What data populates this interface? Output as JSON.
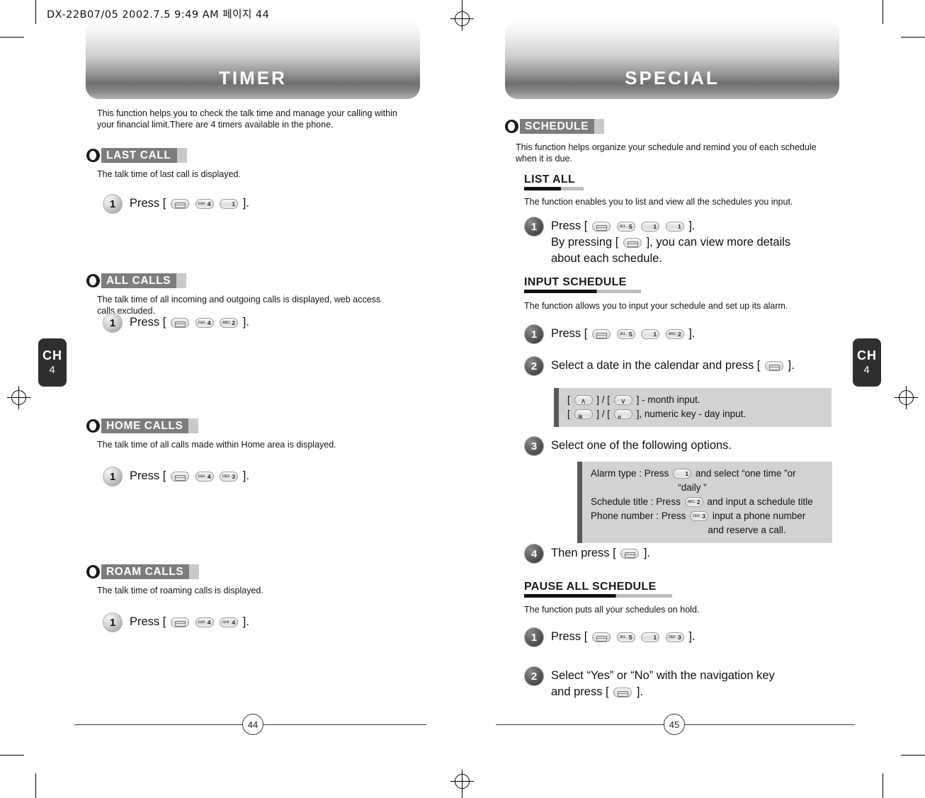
{
  "print_marks": {
    "header_text": "DX-22B07/05  2002.7.5 9:49 AM  페이지 44"
  },
  "left_page": {
    "title": "TIMER",
    "intro": "This function helps you to check the talk time and manage your calling within your financial limit.There are 4 timers available in the phone.",
    "chapter_tab": {
      "line1": "CH",
      "line2": "4"
    },
    "page_number": "44",
    "sections": [
      {
        "tag": "LAST CALL",
        "desc": "The talk time of last call is displayed.",
        "steps": [
          {
            "num": "1",
            "text": "Press [",
            "keys": [
              "send",
              "4ghi",
              "1"
            ],
            "text_end": "]."
          }
        ]
      },
      {
        "tag": "ALL CALLS",
        "desc": "The talk time of all incoming and outgoing calls is displayed, web access calls excluded.",
        "steps": [
          {
            "num": "1",
            "text": "Press [",
            "keys": [
              "send",
              "4ghi",
              "2abc"
            ],
            "text_end": "]."
          }
        ]
      },
      {
        "tag": "HOME CALLS",
        "desc": "The talk time of all calls made within Home area is displayed.",
        "steps": [
          {
            "num": "1",
            "text": "Press [",
            "keys": [
              "send",
              "4ghi",
              "3def"
            ],
            "text_end": "]."
          }
        ]
      },
      {
        "tag": "ROAM CALLS",
        "desc": "The talk time of roaming calls is displayed.",
        "steps": [
          {
            "num": "1",
            "text": "Press [",
            "keys": [
              "send",
              "4ghi",
              "4ghi"
            ],
            "text_end": "]."
          }
        ]
      }
    ]
  },
  "right_page": {
    "title": "SPECIAL",
    "chapter_tab": {
      "line1": "CH",
      "line2": "4"
    },
    "page_number": "45",
    "tag": "SCHEDULE",
    "intro": "This function helps organize your schedule and remind you of each schedule when it is due.",
    "blocks": [
      {
        "heading": "LIST ALL",
        "desc": "The function enables you to list and view all the schedules you input.",
        "steps": [
          {
            "num": "1",
            "line1_a": "Press [",
            "line1_keys": [
              "send",
              "5jkl",
              "1",
              "1"
            ],
            "line1_b": "].",
            "line2_a": "By pressing [",
            "line2_keys": [
              "send"
            ],
            "line2_b": "], you can view  more details",
            "line3": "about each schedule."
          }
        ]
      },
      {
        "heading": "INPUT SCHEDULE",
        "desc": "The function allows you to input your schedule and set up its alarm.",
        "steps": [
          {
            "num": "1",
            "line1_a": "Press [",
            "line1_keys": [
              "send",
              "5jkl",
              "1",
              "2abc"
            ],
            "line1_b": "]."
          },
          {
            "num": "2",
            "line1_a": "Select a date in the calendar and press [",
            "line1_keys": [
              "send"
            ],
            "line1_b": "]."
          },
          {
            "num": "3",
            "line1_a": "Select one of the following options."
          },
          {
            "num": "4",
            "line1_a": "Then press [",
            "line1_keys": [
              "send"
            ],
            "line1_b": "]."
          }
        ],
        "note_after_step2": [
          {
            "pre": "[",
            "key": "nav-up",
            "mid": "] / [",
            "key2": "nav-down",
            "post": "] - month input."
          },
          {
            "pre": "[",
            "key": "star",
            "mid": "] / [",
            "key2": "pound",
            "post": "], numeric key - day input."
          }
        ],
        "note_after_step3": [
          {
            "a": "Alarm type : Press",
            "key": "1",
            "b": "and select “one time ”or"
          },
          {
            "a": "“daily ”"
          },
          {
            "a": "Schedule title : Press",
            "key": "2abc",
            "b": "and input a schedule title"
          },
          {
            "a": "Phone number : Press",
            "key": "3def",
            "b": "input a phone number"
          },
          {
            "a": "and reserve a call."
          }
        ]
      },
      {
        "heading": "PAUSE ALL SCHEDULE",
        "desc": "The function puts all your schedules on hold.",
        "steps": [
          {
            "num": "1",
            "line1_a": "Press [",
            "line1_keys": [
              "send",
              "5jkl",
              "1",
              "3def"
            ],
            "line1_b": "]."
          },
          {
            "num": "2",
            "line1_a": "Select  “Yes”  or  “No”  with  the  navigation  key",
            "line2": "and press [",
            "line2_keys": [
              "send"
            ],
            "line2_b": "]."
          }
        ]
      }
    ]
  }
}
